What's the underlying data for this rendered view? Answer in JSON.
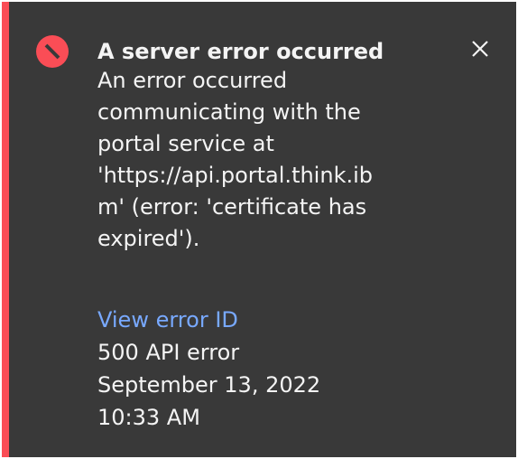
{
  "notification": {
    "kind": "error",
    "title": "A server error occurred",
    "subtitle_lines": [
      "An error occurred",
      "communicating with the",
      "portal service at",
      "'https://api.portal.think.ib",
      "m' (error: 'certificate has",
      "expired')."
    ],
    "link_label": "View error ID",
    "error_code": "500 API error",
    "date": "September 13, 2022",
    "time": "10:33 AM"
  },
  "icons": {
    "status": "error-circle-icon",
    "close": "close-icon"
  },
  "colors": {
    "background": "#393939",
    "accent": "#fa4d56",
    "text": "#f4f4f4",
    "link": "#78a9ff"
  }
}
